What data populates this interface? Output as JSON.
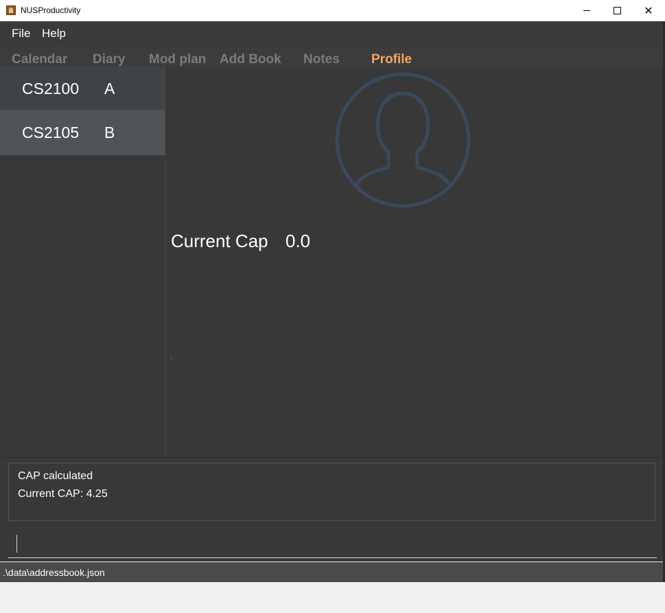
{
  "window": {
    "title": "NUSProductivity",
    "minimize_label": "",
    "maximize_label": "",
    "close_label": "✕"
  },
  "menu": {
    "items": [
      {
        "label": "File"
      },
      {
        "label": "Help"
      }
    ]
  },
  "tabs": [
    {
      "label": "Calendar",
      "active": false
    },
    {
      "label": "Diary",
      "active": false
    },
    {
      "label": "Mod plan",
      "active": false
    },
    {
      "label": "Add Book",
      "active": false
    },
    {
      "label": "Notes",
      "active": false
    },
    {
      "label": "Profile",
      "active": true
    }
  ],
  "modules": [
    {
      "code": "CS2100",
      "grade": "A"
    },
    {
      "code": "CS2105",
      "grade": "B"
    }
  ],
  "profile": {
    "avatar_icon": "user-silhouette-icon",
    "cap_label": "Current Cap",
    "cap_value": "0.0"
  },
  "result": {
    "lines": [
      "CAP calculated",
      "Current CAP: 4.25"
    ]
  },
  "command": {
    "value": ""
  },
  "status": {
    "path": ".\\data\\addressbook.json"
  },
  "colors": {
    "background": "#383838",
    "active_tab": "#f4a460",
    "inactive_tab": "#7b7b7b",
    "selected_row": "#4f5457",
    "avatar_stroke": "#3a4a5c"
  }
}
